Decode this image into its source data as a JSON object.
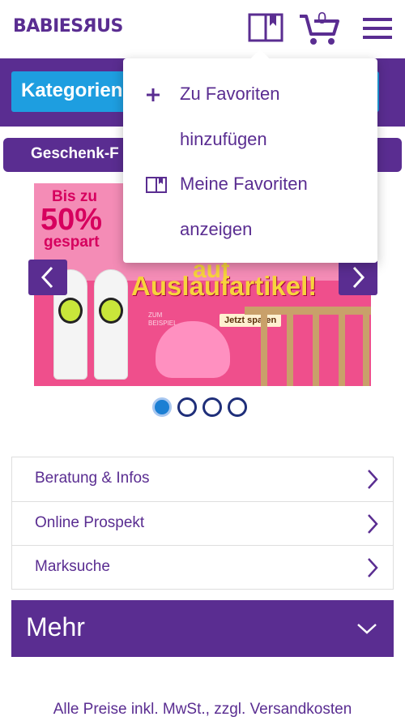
{
  "header": {
    "logo_text": "BABIESRUS",
    "logo_prefix": "BABIES",
    "logo_r": "R",
    "logo_suffix": "US",
    "cart_count": "0",
    "icons": [
      "favorites-icon",
      "cart-icon",
      "hamburger-menu-icon"
    ]
  },
  "nav": {
    "categories_label": "Kategorien",
    "gifts_label": "Geschenk-F"
  },
  "banner": {
    "line1": "Bis zu",
    "line2": "50%",
    "line3": "gespart",
    "line4": "auf",
    "headline": "Auslaufartikel!",
    "small": "ZUM BEISPIEL",
    "cta": "Jetzt sparen",
    "slide_count": 4,
    "active_slide": 1
  },
  "dropdown": {
    "add_line1": "Zu Favoriten",
    "add_line2": "hinzufügen",
    "show_line1": "Meine Favoriten",
    "show_line2": "anzeigen"
  },
  "links": [
    {
      "label": "Beratung & Infos"
    },
    {
      "label": "Online Prospekt"
    },
    {
      "label": "Marksuche"
    }
  ],
  "more_label": "Mehr",
  "footer": "Alle Preise inkl. MwSt., zzgl. Versandkosten",
  "colors": {
    "brand_purple": "#5a2d91",
    "category_blue": "#1e9ee0",
    "banner_pink": "#ef4f8c"
  }
}
